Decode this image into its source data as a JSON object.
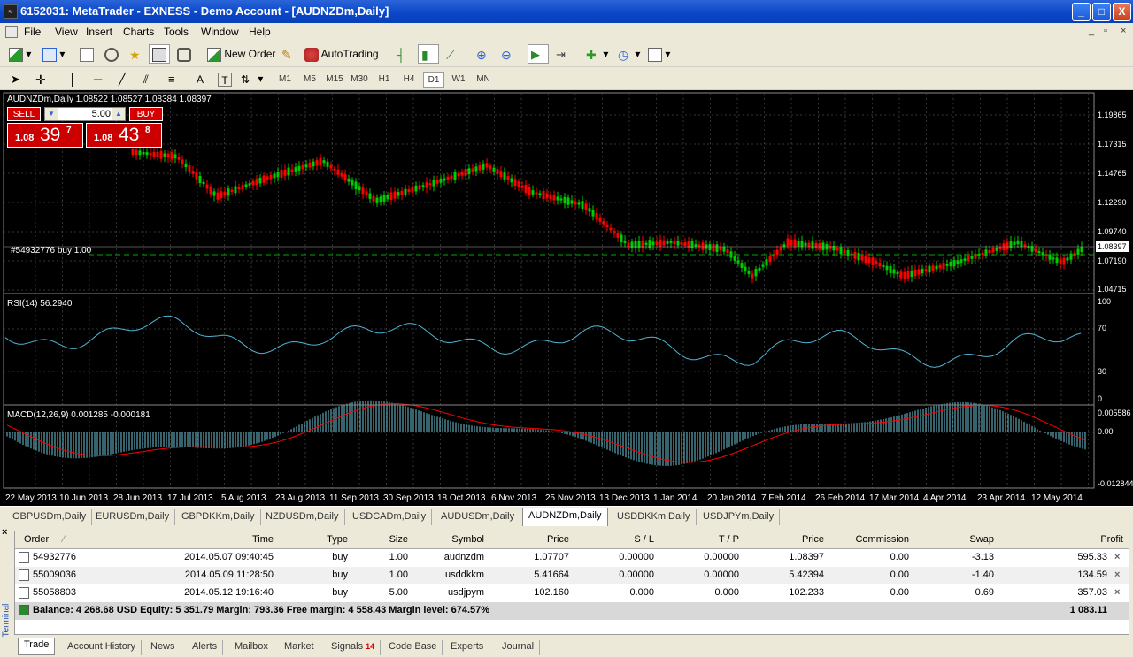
{
  "window": {
    "title": "6152031: MetaTrader - EXNESS - Demo Account - [AUDNZDm,Daily]",
    "minimize": "_",
    "maximize": "□",
    "close": "X"
  },
  "menu": {
    "items": [
      "File",
      "View",
      "Insert",
      "Charts",
      "Tools",
      "Window",
      "Help"
    ],
    "controls": [
      "_",
      "▫",
      "×"
    ]
  },
  "toolbar": {
    "new_order": "New Order",
    "auto_trading": "AutoTrading",
    "timeframes": [
      "M1",
      "M5",
      "M15",
      "M30",
      "H1",
      "H4",
      "D1",
      "W1",
      "MN"
    ],
    "active_timeframe": "D1",
    "search_placeholder": ""
  },
  "oneclick": {
    "sell_label": "SELL",
    "buy_label": "BUY",
    "lot": "5.00",
    "bid_prefix": "1.08",
    "bid_big": "39",
    "bid_sup": "7",
    "ask_prefix": "1.08",
    "ask_big": "43",
    "ask_sup": "8"
  },
  "chart": {
    "title": "AUDNZDm,Daily  1.08522 1.08527 1.08384 1.08397",
    "position_label": "#54932776 buy 1.00",
    "current_price": "1.08397",
    "price_labels": [
      "1.19865",
      "1.17315",
      "1.14765",
      "1.12290",
      "1.09740",
      "1.07190",
      "1.04715"
    ],
    "rsi_title": "RSI(14) 56.2940",
    "rsi_labels": [
      "100",
      "70",
      "30",
      "0"
    ],
    "macd_title": "MACD(12,26,9) 0.001285 -0.000181",
    "macd_labels": [
      "0.005586",
      "0.00",
      "-0.012844"
    ],
    "dates": [
      "22 May 2013",
      "10 Jun 2013",
      "28 Jun 2013",
      "17 Jul 2013",
      "5 Aug 2013",
      "23 Aug 2013",
      "11 Sep 2013",
      "30 Sep 2013",
      "18 Oct 2013",
      "6 Nov 2013",
      "25 Nov 2013",
      "13 Dec 2013",
      "1 Jan 2014",
      "20 Jan 2014",
      "7 Feb 2014",
      "26 Feb 2014",
      "17 Mar 2014",
      "4 Apr 2014",
      "23 Apr 2014",
      "12 May 2014"
    ],
    "colors": {
      "up": "#00cc00",
      "down": "#ff0000",
      "rsi": "#4fb4d4",
      "macd_hist": "#6ec6d8",
      "signal": "#ff0000",
      "grid": "#666666",
      "position_line": "#00aa00"
    }
  },
  "chart_tabs": {
    "items": [
      "GBPUSDm,Daily",
      "EURUSDm,Daily",
      "GBPDKKm,Daily",
      "NZDUSDm,Daily",
      "USDCADm,Daily",
      "AUDUSDm,Daily",
      "AUDNZDm,Daily",
      "USDDKKm,Daily",
      "USDJPYm,Daily"
    ],
    "active": "AUDNZDm,Daily"
  },
  "terminal": {
    "side_label": "Terminal",
    "close": "×",
    "columns": [
      "Order",
      "Time",
      "Type",
      "Size",
      "Symbol",
      "Price",
      "S / L",
      "T / P",
      "Price",
      "Commission",
      "Swap",
      "Profit"
    ],
    "rows": [
      {
        "order": "54932776",
        "time": "2014.05.07 09:40:45",
        "type": "buy",
        "size": "1.00",
        "symbol": "audnzdm",
        "price": "1.07707",
        "sl": "0.00000",
        "tp": "0.00000",
        "cur": "1.08397",
        "commission": "0.00",
        "swap": "-3.13",
        "profit": "595.33"
      },
      {
        "order": "55009036",
        "time": "2014.05.09 11:28:50",
        "type": "buy",
        "size": "1.00",
        "symbol": "usddkkm",
        "price": "5.41664",
        "sl": "0.00000",
        "tp": "0.00000",
        "cur": "5.42394",
        "commission": "0.00",
        "swap": "-1.40",
        "profit": "134.59"
      },
      {
        "order": "55058803",
        "time": "2014.05.12 19:16:40",
        "type": "buy",
        "size": "5.00",
        "symbol": "usdjpym",
        "price": "102.160",
        "sl": "0.000",
        "tp": "0.000",
        "cur": "102.233",
        "commission": "0.00",
        "swap": "0.69",
        "profit": "357.03"
      }
    ],
    "balance_line": "Balance: 4 268.68 USD  Equity: 5 351.79  Margin: 793.36  Free margin: 4 558.43  Margin level: 674.57%",
    "total_profit": "1 083.11",
    "tabs": [
      "Trade",
      "Account History",
      "News",
      "Alerts",
      "Mailbox",
      "Market",
      "Signals",
      "Code Base",
      "Experts",
      "Journal"
    ],
    "signals_badge": "14",
    "active_tab": "Trade"
  }
}
